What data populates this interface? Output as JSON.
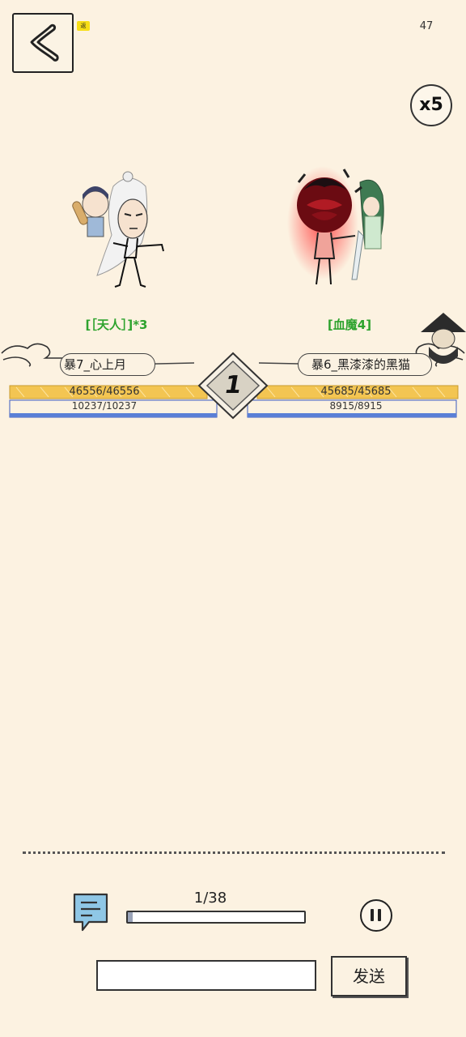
{
  "top_bar": {
    "back_icon": "chevron-left-icon",
    "status_number": "47",
    "speed_label": "x5"
  },
  "battle": {
    "left": {
      "tag": "[［天人］]*3",
      "name": "暴7_心上月",
      "hp": "46556/46556",
      "mp": "10237/10237",
      "hp_fraction": 1.0,
      "mp_fraction": 1.0
    },
    "right": {
      "tag": "[血魔4]",
      "name": "暴6_黑漆漆的黑猫",
      "hp": "45685/45685",
      "mp": "8915/8915",
      "hp_fraction": 1.0,
      "mp_fraction": 1.0
    },
    "round": "1"
  },
  "bottom": {
    "chat_icon": "chat-bubble-icon",
    "progress_text": "1/38",
    "progress_fraction": 0.026,
    "pause_icon": "pause-icon",
    "message_input_value": "",
    "send_label": "发送"
  },
  "colors": {
    "background": "#fcf2e1",
    "hp_bar": "#f3c552",
    "mp_bar": "#5a7fd6",
    "tag_green": "#2ea32e",
    "right_aura": "#e0242a"
  }
}
